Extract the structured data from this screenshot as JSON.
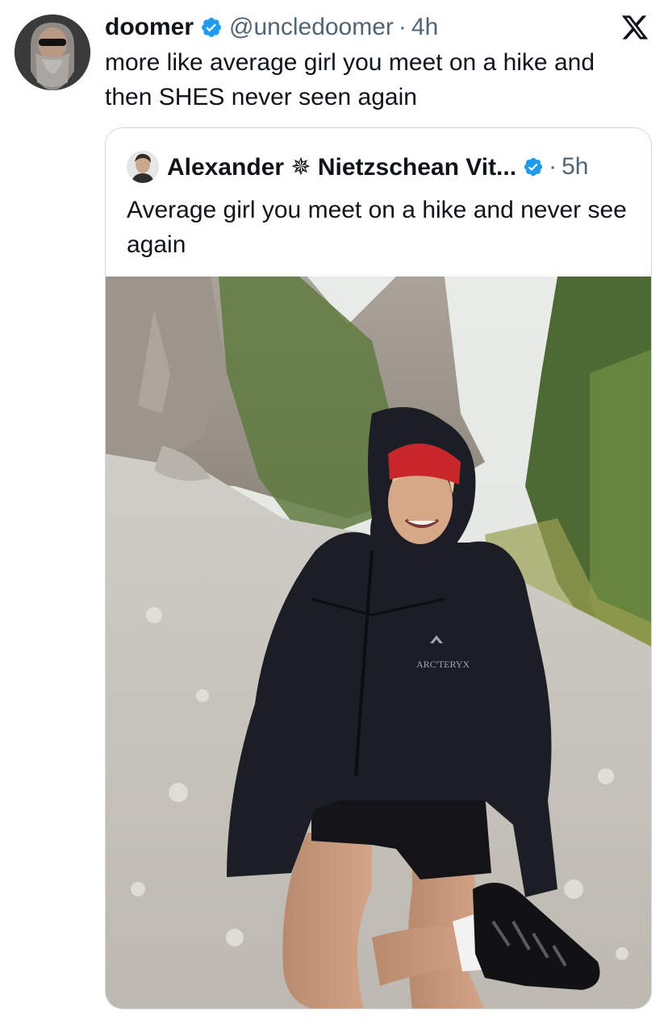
{
  "tweet": {
    "display_name": "doomer",
    "handle": "@uncledoomer",
    "separator": "·",
    "time": "4h",
    "text": "more like average girl you meet on a hike and then SHES never seen again",
    "avatar_icon": "bearded-man-sunglasses-avatar",
    "verified_icon": "verified-badge-icon"
  },
  "brand": {
    "logo_icon": "x-logo-icon"
  },
  "quoted_tweet": {
    "display_name": "Alexander ✵ Nietzschean Vit...",
    "separator": "·",
    "time": "5h",
    "text": "Average girl you meet on a hike and never see again",
    "avatar_icon": "man-portrait-avatar",
    "verified_icon": "verified-badge-icon",
    "media": {
      "kind": "photo",
      "jacket_logo_text": "ARC'TERYX"
    }
  },
  "colors": {
    "text_primary": "#0f1419",
    "text_secondary": "#536471",
    "verified_blue": "#1d9bf0",
    "card_border": "#cfd9de"
  }
}
